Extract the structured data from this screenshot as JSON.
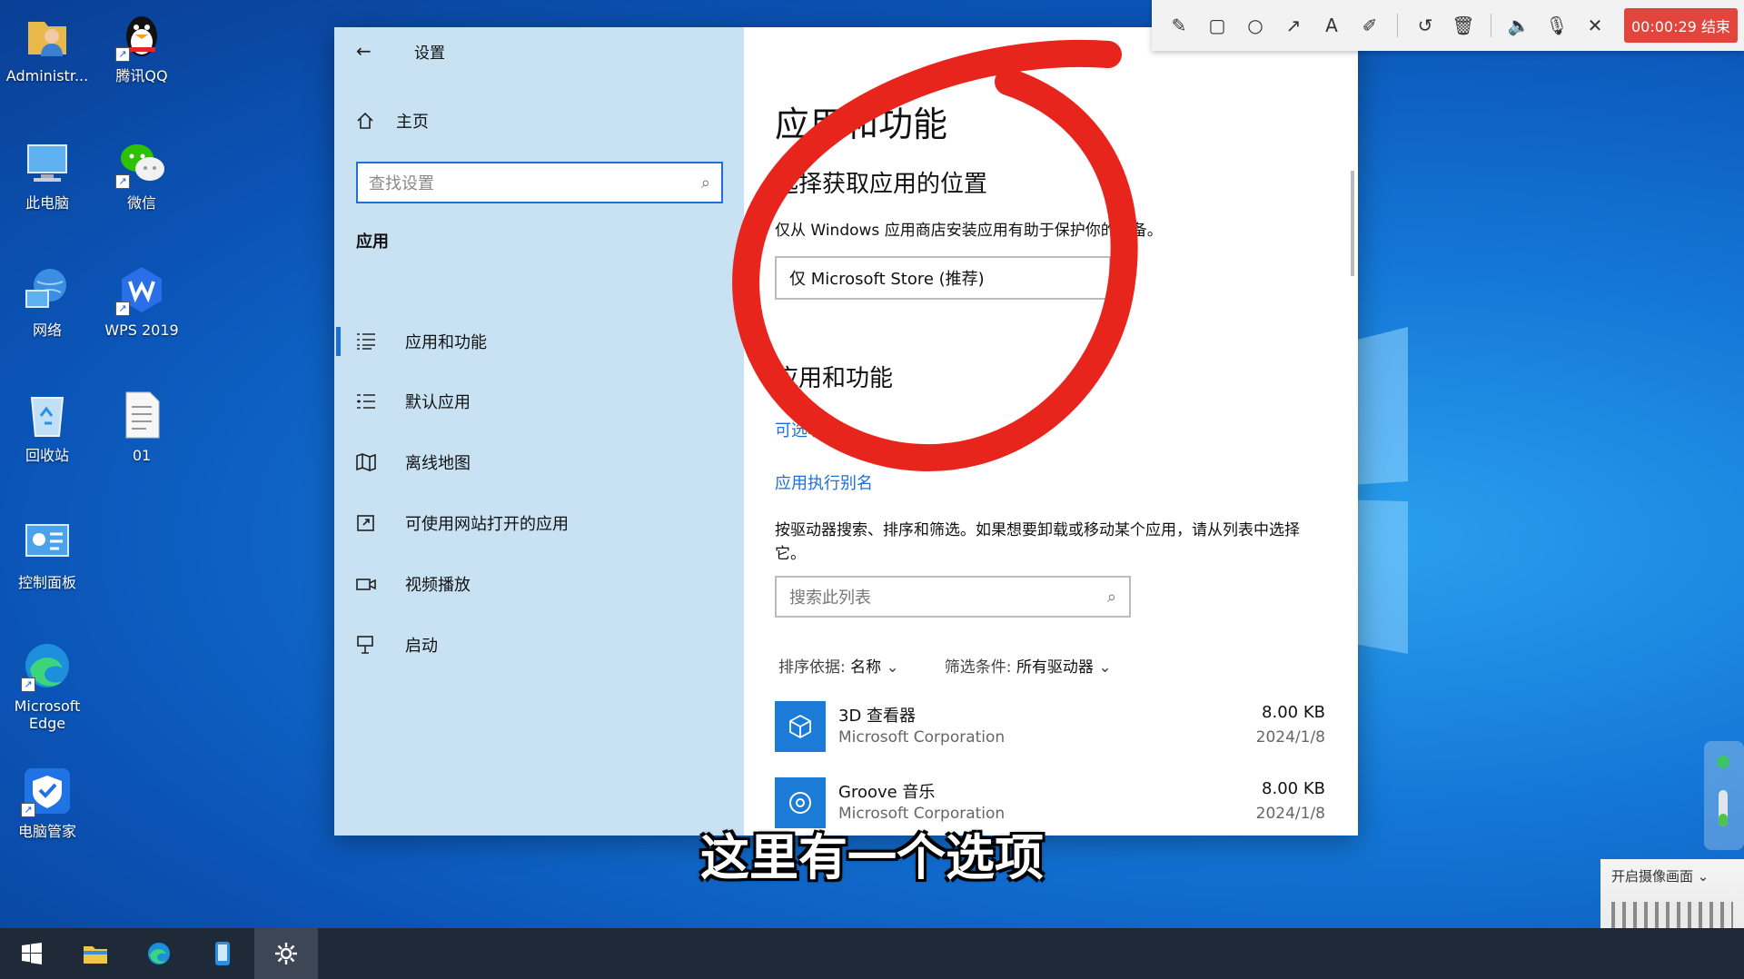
{
  "desktop": {
    "icons": [
      {
        "label": "Administr...",
        "icon": "user-folder-icon"
      },
      {
        "label": "腾讯QQ",
        "icon": "qq-icon"
      },
      {
        "label": "此电脑",
        "icon": "computer-icon"
      },
      {
        "label": "微信",
        "icon": "wechat-icon"
      },
      {
        "label": "网络",
        "icon": "network-icon"
      },
      {
        "label": "WPS 2019",
        "icon": "wps-icon"
      },
      {
        "label": "回收站",
        "icon": "recycle-bin-icon"
      },
      {
        "label": "01",
        "icon": "document-icon"
      },
      {
        "label": "控制面板",
        "icon": "control-panel-icon"
      },
      {
        "label": "Microsoft Edge",
        "icon": "edge-icon"
      },
      {
        "label": "电脑管家",
        "icon": "pc-manager-icon"
      }
    ]
  },
  "settings": {
    "window_title": "设置",
    "home_label": "主页",
    "search_placeholder": "查找设置",
    "section_label": "应用",
    "nav_items": [
      {
        "label": "应用和功能",
        "icon": "apps-list-icon",
        "active": true
      },
      {
        "label": "默认应用",
        "icon": "default-apps-icon"
      },
      {
        "label": "离线地图",
        "icon": "map-icon"
      },
      {
        "label": "可使用网站打开的应用",
        "icon": "web-apps-icon"
      },
      {
        "label": "视频播放",
        "icon": "video-icon"
      },
      {
        "label": "启动",
        "icon": "startup-icon"
      }
    ],
    "content": {
      "page_title": "应用和功能",
      "install_heading": "选择获取应用的位置",
      "install_desc": "仅从 Windows 应用商店安装应用有助于保护你的设备。",
      "install_dropdown_value": "仅 Microsoft Store (推荐)",
      "apps_heading": "应用和功能",
      "optional_features_link": "可选功能",
      "alias_link": "应用执行别名",
      "list_desc": "按驱动器搜索、排序和筛选。如果想要卸载或移动某个应用，请从列表中选择它。",
      "list_search_placeholder": "搜索此列表",
      "sort_label": "排序依据:",
      "sort_value": "名称",
      "filter_label": "筛选条件:",
      "filter_value": "所有驱动器",
      "apps": [
        {
          "name": "3D 查看器",
          "publisher": "Microsoft Corporation",
          "size": "8.00 KB",
          "date": "2024/1/8",
          "icon": "3d-viewer-icon"
        },
        {
          "name": "Groove 音乐",
          "publisher": "Microsoft Corporation",
          "size": "8.00 KB",
          "date": "2024/1/8",
          "icon": "groove-music-icon"
        }
      ]
    }
  },
  "recorder": {
    "tools": [
      "pencil-icon",
      "rectangle-icon",
      "circle-icon",
      "arrow-icon",
      "text-icon",
      "highlighter-icon",
      "undo-icon",
      "trash-icon",
      "speaker-icon",
      "microphone-icon",
      "close-icon"
    ],
    "end_label": "00:00:29 结束"
  },
  "subtitle": "这里有一个选项",
  "corner_popup_text": "开启摄像画面",
  "taskbar": {
    "items": [
      "start-icon",
      "file-explorer-icon",
      "edge-icon",
      "phone-icon",
      "settings-gear-icon"
    ]
  },
  "colors": {
    "accent": "#1f6fd6",
    "nav_bg": "#c9e2f3",
    "annotation_red": "#e8251c",
    "record_end_bg": "#e2453c"
  }
}
